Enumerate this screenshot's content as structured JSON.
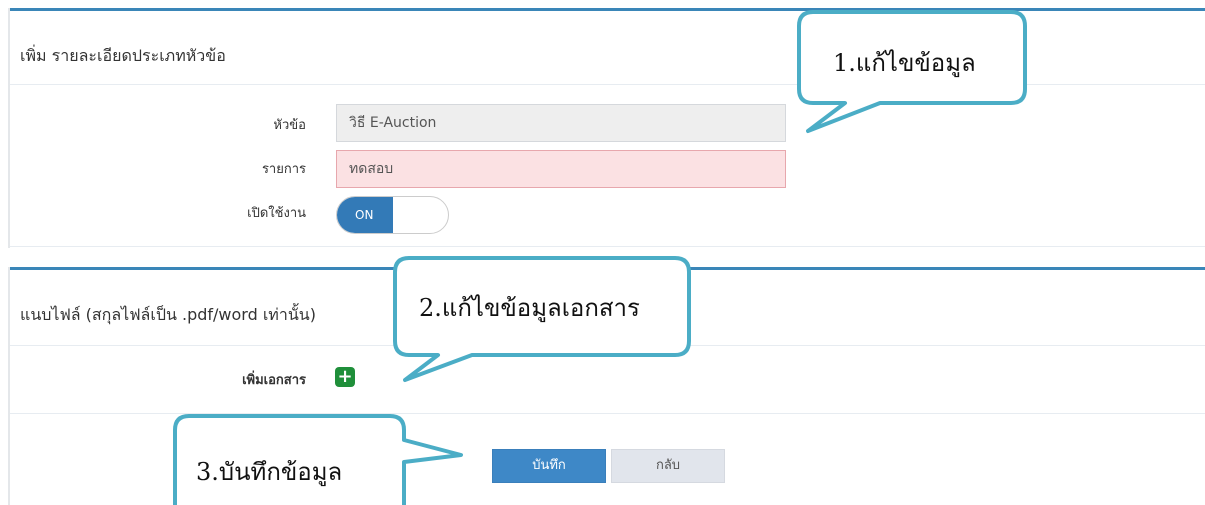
{
  "section1": {
    "title": "เพิ่ม รายละเอียดประเภทหัวข้อ",
    "fields": {
      "topic": {
        "label": "หัวข้อ",
        "value": "วิธี E-Auction"
      },
      "item": {
        "label": "รายการ",
        "value": "ทดสอบ"
      },
      "enabled": {
        "label": "เปิดใช้งาน",
        "state": "ON"
      }
    }
  },
  "section2": {
    "title": "แนบไฟล์ (สกุลไฟล์เป็น .pdf/word เท่านั้น)",
    "add_document_label": "เพิ่มเอกสาร"
  },
  "actions": {
    "save_label": "บันทึก",
    "back_label": "กลับ"
  },
  "callouts": {
    "one": "1.แก้ไขข้อมูล",
    "two": "2.แก้ไขข้อมูลเอกสาร",
    "three": "3.บันทึกข้อมูล"
  },
  "colors": {
    "accent": "#3a86b8",
    "callout_border": "#4badc6",
    "primary_button": "#3e88c7",
    "add_icon": "#1f8f3a",
    "error_field": "#fbe1e3"
  }
}
